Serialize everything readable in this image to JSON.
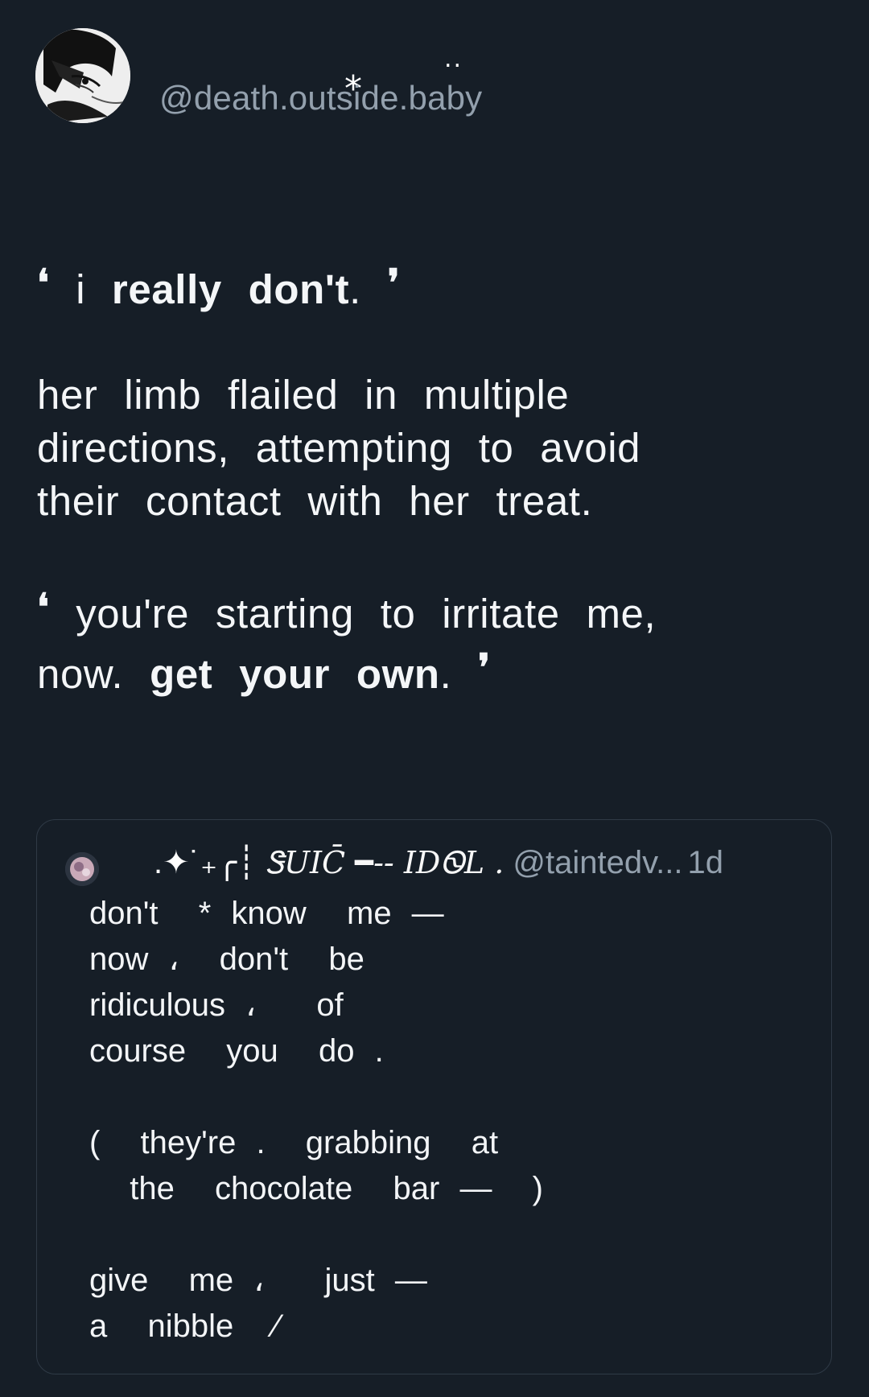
{
  "post": {
    "display_name": "*",
    "display_name_tail": "..",
    "handle": "@death.outside.baby",
    "paragraph1": {
      "open_quote": "❛",
      "plain1": " i ",
      "bold1": "really",
      "mid": " ",
      "bold2": "don't",
      "end": ". ",
      "close_quote": "❜"
    },
    "paragraph2": "her limb flailed in multiple\ndirections, attempting to avoid\ntheir contact with her treat.",
    "paragraph3": {
      "open_quote": "❛",
      "plain": " you're starting to irritate me,\nnow. ",
      "bold": "get your own",
      "end": ". ",
      "close_quote": "❜"
    }
  },
  "quoted_post": {
    "author_prefix": ".✦˙₊╭┊",
    "author_name": "ᏕUIC̄ ━-- IDᏫL .",
    "handle": "@taintedv...",
    "time": "1d",
    "text": "don't  * know  me —\nnow ،  don't  be\nridiculous ،   of\ncourse  you  do .\n\n(  they're .  grabbing  at\n  the  chocolate  bar —  )\n\ngive  me ،   just —\na  nibble  ⁄"
  }
}
